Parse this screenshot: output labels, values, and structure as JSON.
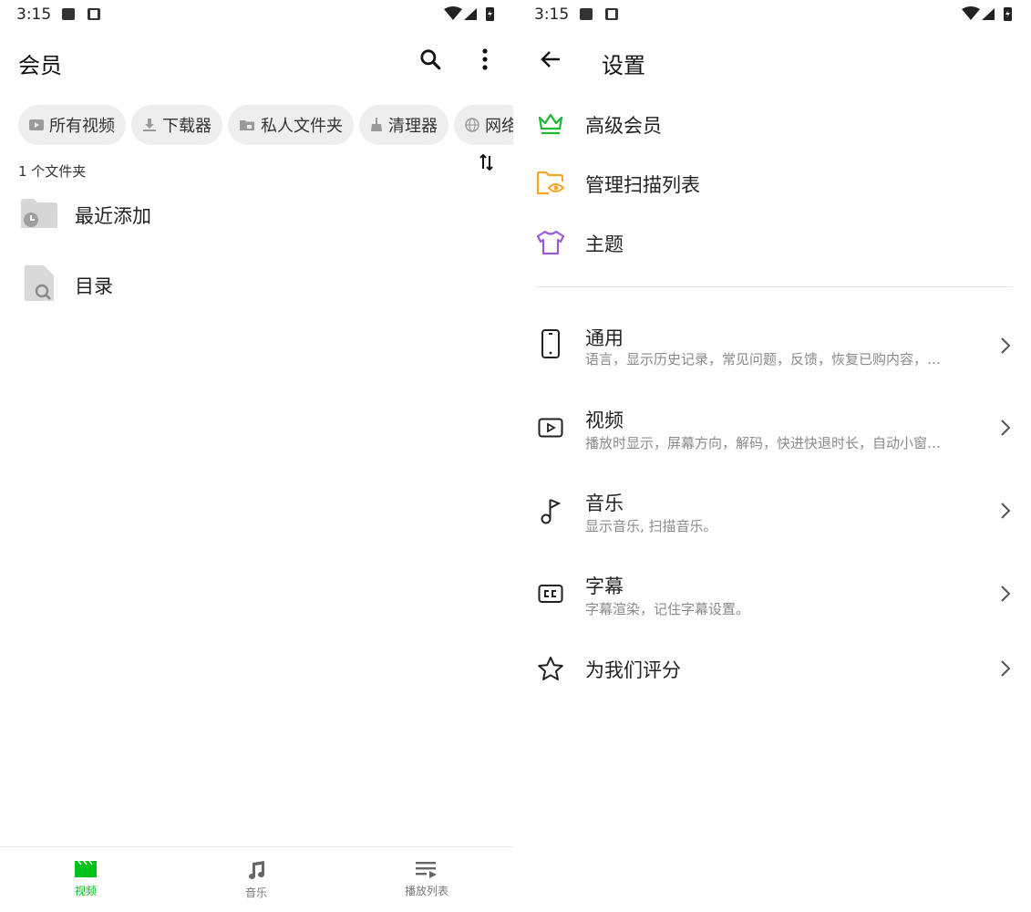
{
  "status_bar": {
    "time": "3:15"
  },
  "left": {
    "title": "会员",
    "chips": [
      {
        "label": "所有视频",
        "icon": "play-box-icon"
      },
      {
        "label": "下载器",
        "icon": "download-icon"
      },
      {
        "label": "私人文件夹",
        "icon": "lock-folder-icon"
      },
      {
        "label": "清理器",
        "icon": "broom-icon"
      },
      {
        "label": "网络",
        "icon": "globe-icon"
      }
    ],
    "folder_count": "1 个文件夹",
    "folders": [
      {
        "label": "最近添加",
        "icon": "recent-folder-icon"
      },
      {
        "label": "目录",
        "icon": "search-file-icon"
      }
    ],
    "bottom_nav": [
      {
        "label": "视频",
        "icon": "video-icon",
        "active": true
      },
      {
        "label": "音乐",
        "icon": "music-note-icon",
        "active": false
      },
      {
        "label": "播放列表",
        "icon": "playlist-icon",
        "active": false
      }
    ]
  },
  "right": {
    "title": "设置",
    "top_items": [
      {
        "label": "高级会员",
        "icon": "crown-icon"
      },
      {
        "label": "管理扫描列表",
        "icon": "folder-eye-icon"
      },
      {
        "label": "主题",
        "icon": "shirt-icon"
      }
    ],
    "settings": [
      {
        "label": "通用",
        "sub": "语言，显示历史记录，常见问题，反馈，恢复已购内容，…",
        "icon": "phone-icon"
      },
      {
        "label": "视频",
        "sub": "播放时显示，屏幕方向，解码，快进快退时长，自动小窗…",
        "icon": "video-play-icon"
      },
      {
        "label": "音乐",
        "sub": "显示音乐, 扫描音乐。",
        "icon": "music-icon"
      },
      {
        "label": "字幕",
        "sub": "字幕渲染，记住字幕设置。",
        "icon": "cc-icon"
      },
      {
        "label": "为我们评分",
        "sub": "",
        "icon": "star-icon"
      }
    ]
  },
  "colors": {
    "accent": "#00c219",
    "crown": "#1fb832",
    "folder": "#f5a623",
    "shirt": "#9b59d6"
  }
}
